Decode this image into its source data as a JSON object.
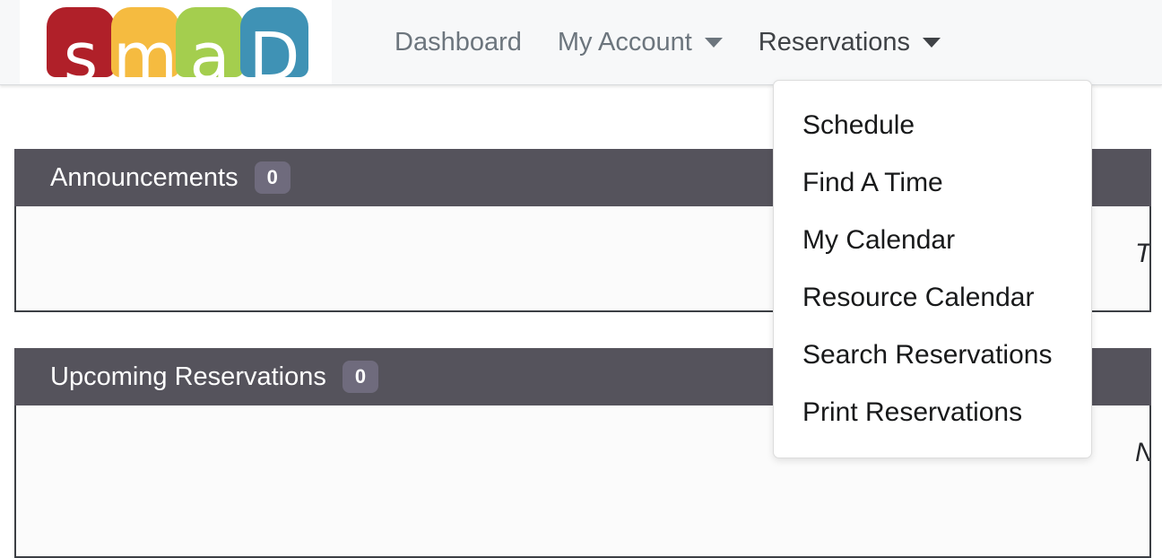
{
  "navbar": {
    "logo": {
      "name": "smad-logo",
      "tiles": [
        {
          "letter": "s",
          "color": "#b02029"
        },
        {
          "letter": "m",
          "color": "#f5bb40"
        },
        {
          "letter": "a",
          "color": "#a4ce4e"
        },
        {
          "letter": "D",
          "color": "#3f92b5"
        }
      ]
    },
    "links": [
      {
        "label": "Dashboard",
        "has_caret": false,
        "active": false
      },
      {
        "label": "My Account",
        "has_caret": true,
        "active": false
      },
      {
        "label": "Reservations",
        "has_caret": true,
        "active": true
      }
    ]
  },
  "dropdown": {
    "owner": "Reservations",
    "items": [
      {
        "label": "Schedule"
      },
      {
        "label": "Find A Time"
      },
      {
        "label": "My Calendar"
      },
      {
        "label": "Resource Calendar"
      },
      {
        "label": "Search Reservations"
      },
      {
        "label": "Print Reservations"
      }
    ]
  },
  "panels": [
    {
      "id": "announcements",
      "title": "Announcements",
      "count": "0",
      "empty_text": "There are no announcements."
    },
    {
      "id": "upcoming",
      "title": "Upcoming Reservations",
      "count": "0",
      "empty_text": "No upcoming reservations."
    }
  ],
  "colors": {
    "navbar_bg": "#f7f8f9",
    "panel_header_bg": "#55535c",
    "badge_bg": "#6f6b7d",
    "nav_link": "#6c757d"
  }
}
